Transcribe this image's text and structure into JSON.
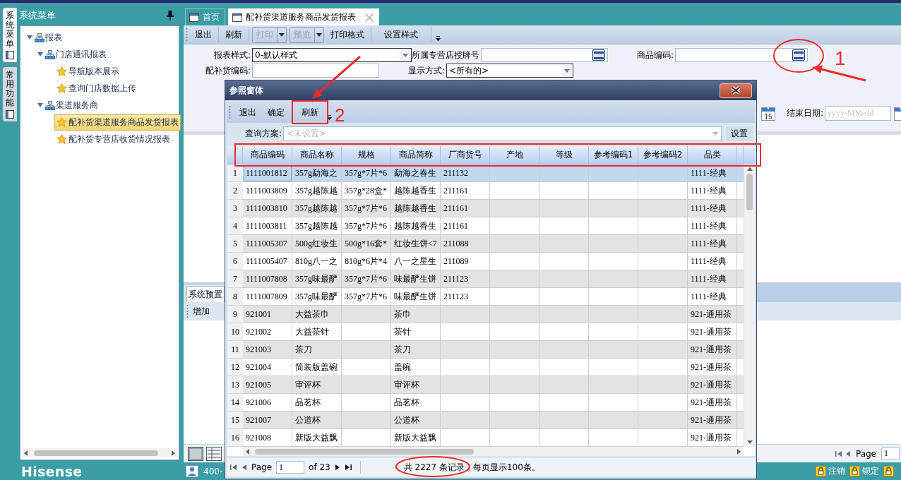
{
  "side_tabs": [
    {
      "label": "系统菜单",
      "selected": true
    },
    {
      "label": "常用功能",
      "selected": false
    }
  ],
  "menu": {
    "title": "系统菜单",
    "tree": [
      {
        "label": "报表",
        "expanded": true,
        "children": [
          {
            "label": "门店通讯报表",
            "expanded": true,
            "children": [
              {
                "label": "导航版本展示",
                "selected": false
              },
              {
                "label": "查询门店数据上传",
                "selected": false
              }
            ]
          },
          {
            "label": "渠道服务商",
            "expanded": true,
            "children": [
              {
                "label": "配补货渠道服务商品发货报表",
                "selected": true
              },
              {
                "label": "配补货专营店收货情况报表",
                "selected": false
              }
            ]
          }
        ]
      }
    ]
  },
  "tabs": [
    {
      "label": "首页",
      "selected": false,
      "closable": false
    },
    {
      "label": "配补货渠道服务商品发货报表",
      "selected": true,
      "closable": true
    }
  ],
  "toolbar": [
    {
      "label": "退出",
      "disabled": false,
      "dropdown": false
    },
    {
      "label": "刷新",
      "disabled": false,
      "dropdown": false
    },
    {
      "label": "打印",
      "disabled": true,
      "dropdown": true
    },
    {
      "label": "预览",
      "disabled": true,
      "dropdown": true
    },
    {
      "label": "打印格式",
      "disabled": false,
      "dropdown": false
    },
    {
      "label": "设置样式",
      "disabled": false,
      "dropdown": false
    }
  ],
  "form": {
    "row_1": [
      {
        "kind": "combo",
        "label": "报表样式:",
        "value": "0-默认样式"
      },
      {
        "kind": "lookup",
        "label": "所属专营店授牌号"
      },
      {
        "kind": "lookup",
        "label": "商品编码:",
        "callout": "1"
      }
    ],
    "row_2": [
      {
        "kind": "text",
        "label": "配补货编码:"
      },
      {
        "kind": "combo",
        "label": "显示方式:",
        "value": "<所有的>"
      }
    ],
    "row_3": [
      {
        "kind": "calendar",
        "day": "15"
      },
      {
        "kind": "date",
        "label": "结束日期:",
        "placeholder": "yyyy-MM-dd"
      },
      {
        "kind": "calendar-edge"
      }
    ]
  },
  "lower_panel": {
    "tabs": [
      {
        "label": "系统预置",
        "selected": true
      }
    ],
    "toolbar": [
      "增加"
    ],
    "pager": {
      "label": "Page",
      "page": "1"
    }
  },
  "dialog": {
    "title": "参照窗体",
    "toolbar": [
      {
        "label": "退出"
      },
      {
        "label": "确定"
      },
      {
        "label": "刷新",
        "callout": "2"
      }
    ],
    "query": {
      "label": "查询方案:",
      "placeholder": "<未设置>",
      "disabled": true,
      "button": "设置"
    },
    "table": {
      "header_boxed": true,
      "columns": [
        "商品编码",
        "商品名称",
        "规格",
        "商品简称",
        "厂商货号",
        "产地",
        "等级",
        "参考编码1",
        "参考编码2",
        "品类"
      ],
      "rows": [
        {
          "no": "1",
          "selected": true,
          "code": "1111001812",
          "name": "357g勐海之",
          "spec": "357g*7片*6",
          "short_name": "勐海之春生",
          "vendor_no": "211132",
          "category": "1111-经典"
        },
        {
          "no": "2",
          "selected": false,
          "code": "1111003809",
          "name": "357g越陈越",
          "spec": "357g*28盒*",
          "short_name": "越陈越香生",
          "vendor_no": "211161",
          "category": "1111-经典"
        },
        {
          "no": "3",
          "selected": false,
          "code": "1111003810",
          "name": "357g越陈越",
          "spec": "357g*7片*6",
          "short_name": "越陈越香生",
          "vendor_no": "211161",
          "category": "1111-经典"
        },
        {
          "no": "4",
          "selected": false,
          "code": "1111003811",
          "name": "357g越陈越",
          "spec": "357g*7片*6",
          "short_name": "越陈越香生",
          "vendor_no": "211161",
          "category": "1111-经典"
        },
        {
          "no": "5",
          "selected": false,
          "code": "1111005307",
          "name": "500g红妆生",
          "spec": "500g*16套*",
          "short_name": "红妆生饼<7",
          "vendor_no": "211088",
          "category": "1111-经典"
        },
        {
          "no": "6",
          "selected": false,
          "code": "1111005407",
          "name": "810g八一之",
          "spec": "810g*6片*4",
          "short_name": "八一之星生",
          "vendor_no": "211089",
          "category": "1111-经典"
        },
        {
          "no": "7",
          "selected": false,
          "code": "1111007808",
          "name": "357g味最酽",
          "spec": "357g*7片*6",
          "short_name": "味最酽生饼",
          "vendor_no": "211123",
          "category": "1111-经典"
        },
        {
          "no": "8",
          "selected": false,
          "code": "1111007809",
          "name": "357g味最酽",
          "spec": "357g*7片*6",
          "short_name": "味最酽生饼",
          "vendor_no": "211123",
          "category": "1111-经典"
        },
        {
          "no": "9",
          "selected": false,
          "code": "921001",
          "name": "大益茶巾",
          "short_name": "茶巾",
          "category": "921-通用茶"
        },
        {
          "no": "10",
          "selected": false,
          "code": "921002",
          "name": "大益茶针",
          "short_name": "茶针",
          "category": "921-通用茶"
        },
        {
          "no": "11",
          "selected": false,
          "code": "921003",
          "name": "茶刀",
          "short_name": "茶刀",
          "category": "921-通用茶"
        },
        {
          "no": "12",
          "selected": false,
          "code": "921004",
          "name": "简装版盖碗",
          "short_name": "盖碗",
          "category": "921-通用茶"
        },
        {
          "no": "13",
          "selected": false,
          "code": "921005",
          "name": "审评杯",
          "short_name": "审评杯",
          "category": "921-通用茶"
        },
        {
          "no": "14",
          "selected": false,
          "code": "921006",
          "name": "品茗杯",
          "short_name": "品茗杯",
          "category": "921-通用茶"
        },
        {
          "no": "15",
          "selected": false,
          "code": "921007",
          "name": "公道杯",
          "short_name": "公道杯",
          "category": "921-通用茶"
        },
        {
          "no": "16",
          "selected": false,
          "code": "921008",
          "name": "新版大益飘",
          "short_name": "新版大益飘",
          "category": "921-通用茶"
        }
      ]
    },
    "pager": {
      "page_label": "Page",
      "page": "1",
      "of": "of 23",
      "summary": "共 2227 条记录，每页显示100条。",
      "count_circled": true
    }
  },
  "status_bar": {
    "logo": "Hisense",
    "user": "400-",
    "actions": [
      "注销",
      "锁定"
    ]
  }
}
